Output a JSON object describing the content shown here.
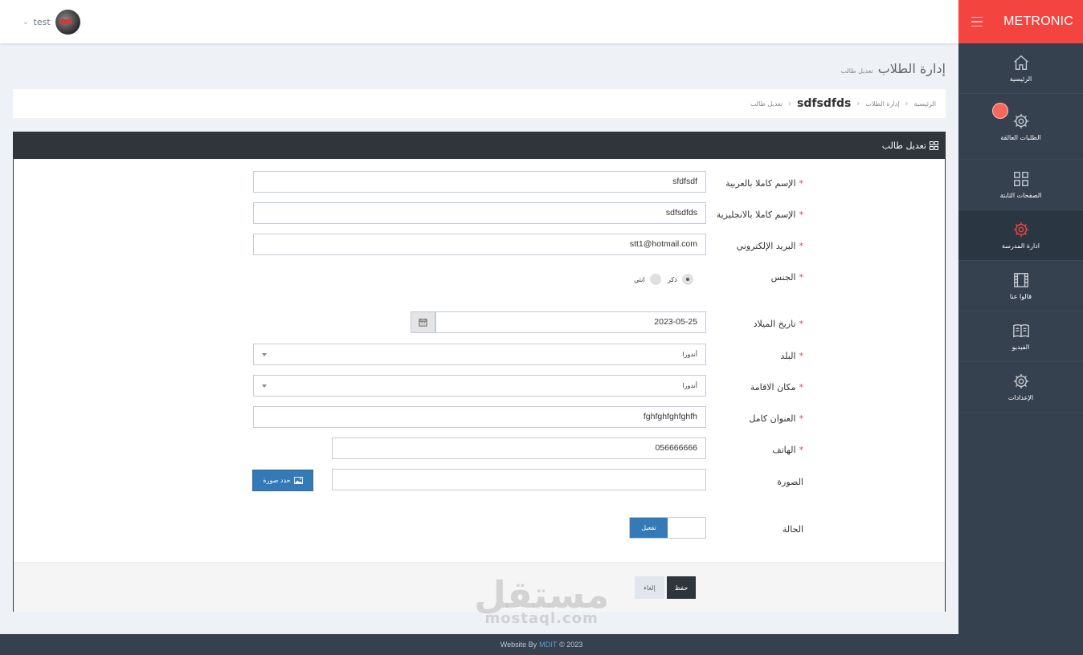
{
  "sidebar": {
    "brand": "METRONIC",
    "items": [
      {
        "label": "الرئيسية",
        "icon": "home-icon"
      },
      {
        "label": "الطلبات العالقة",
        "icon": "gear-icon"
      },
      {
        "label": "الصفحات الثابتة",
        "icon": "grid-icon"
      },
      {
        "label": "ادارة المدرسة",
        "icon": "gear-icon"
      },
      {
        "label": "قالوا عنا",
        "icon": "film-icon"
      },
      {
        "label": "الفيديو",
        "icon": "book-icon"
      },
      {
        "label": "الإعدادات",
        "icon": "gear-icon"
      }
    ]
  },
  "header": {
    "username": "test"
  },
  "page": {
    "title": "إدارة الطلاب",
    "subtitle": "تعديل طالب",
    "breadcrumbs": [
      "الرئيسية",
      "إدارة الطلاب",
      "تعديل طالب"
    ],
    "current": "sdfsdfds"
  },
  "portlet": {
    "title": "تعديل طالب"
  },
  "form": {
    "name_ar": {
      "label": "الإسم كاملا بالعربية",
      "value": "sfdfsdf"
    },
    "name_en": {
      "label": "الإسم كاملا بالانجليزية",
      "value": "sdfsdfds"
    },
    "email": {
      "label": "البريد الإلكتروني",
      "value": "stt1@hotmail.com"
    },
    "gender": {
      "label": "الجنس",
      "options": [
        "ذكر",
        "انثي"
      ],
      "selected": "ذكر"
    },
    "birthdate": {
      "label": "تاريخ الميلاد",
      "value": "2023-05-25"
    },
    "country": {
      "label": "البلد",
      "value": "أندورا"
    },
    "residence": {
      "label": "مكان الاقامة",
      "value": "أندورا"
    },
    "address": {
      "label": "العنوان كامل",
      "value": "fghfghfghfghfh"
    },
    "phone": {
      "label": "الهاتف",
      "value": "056666666"
    },
    "photo": {
      "label": "الصورة",
      "button": "حدد صورة",
      "value": ""
    },
    "status": {
      "label": "الحالة",
      "toggle_label": "تفعيل"
    },
    "save": "حفظ",
    "cancel": "إلغاء"
  },
  "watermark": {
    "ar": "مستقل",
    "en": "mostaql.com"
  },
  "footer": {
    "prefix": "Website By",
    "brand": "MDIT",
    "suffix": "© 2023"
  },
  "colors": {
    "accent": "#f3443f",
    "sidebar": "#364150",
    "primary": "#337ab7",
    "dark": "#2f353b",
    "required": "#e73d4a"
  }
}
